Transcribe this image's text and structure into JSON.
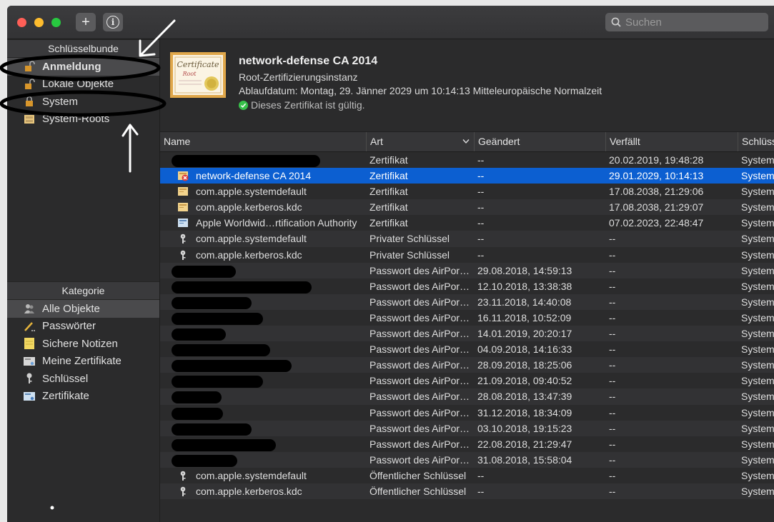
{
  "search": {
    "placeholder": "Suchen"
  },
  "sidebar": {
    "keychains_header": "Schlüsselbunde",
    "keychains": [
      {
        "label": "Anmeldung",
        "selected": true
      },
      {
        "label": "Lokale Objekte"
      },
      {
        "label": "System"
      },
      {
        "label": "System-Roots"
      }
    ],
    "category_header": "Kategorie",
    "categories": [
      {
        "label": "Alle Objekte",
        "selected": true
      },
      {
        "label": "Passwörter"
      },
      {
        "label": "Sichere Notizen"
      },
      {
        "label": "Meine Zertifikate"
      },
      {
        "label": "Schlüssel"
      },
      {
        "label": "Zertifikate"
      }
    ]
  },
  "detail": {
    "title": "network-defense CA 2014",
    "subtitle": "Root-Zertifizierungsinstanz",
    "expiry": "Ablaufdatum: Montag, 29. Jänner 2029 um 10:14:13 Mitteleuropäische Normalzeit",
    "valid": "Dieses Zertifikat ist gültig.",
    "cert_text1": "Certificate",
    "cert_text2": "Root"
  },
  "table": {
    "columns": [
      "Name",
      "Art",
      "Geändert",
      "Verfällt",
      "Schlüss"
    ],
    "rows": [
      {
        "name": "",
        "art": "Zertifikat",
        "mod": "--",
        "exp": "20.02.2019, 19:48:28",
        "kc": "System",
        "icon": "none",
        "redact": 208
      },
      {
        "name": "network-defense CA 2014",
        "art": "Zertifikat",
        "mod": "--",
        "exp": "29.01.2029, 10:14:13",
        "kc": "System",
        "icon": "cert-invalid",
        "selected": true
      },
      {
        "name": "com.apple.systemdefault",
        "art": "Zertifikat",
        "mod": "--",
        "exp": "17.08.2038, 21:29:06",
        "kc": "System",
        "icon": "cert"
      },
      {
        "name": "com.apple.kerberos.kdc",
        "art": "Zertifikat",
        "mod": "--",
        "exp": "17.08.2038, 21:29:07",
        "kc": "System",
        "icon": "cert"
      },
      {
        "name": "Apple Worldwid…rtification Authority",
        "art": "Zertifikat",
        "mod": "--",
        "exp": "07.02.2023, 22:48:47",
        "kc": "System",
        "icon": "cert-blue"
      },
      {
        "name": "com.apple.systemdefault",
        "art": "Privater Schlüssel",
        "mod": "--",
        "exp": "--",
        "kc": "System",
        "icon": "key"
      },
      {
        "name": "com.apple.kerberos.kdc",
        "art": "Privater Schlüssel",
        "mod": "--",
        "exp": "--",
        "kc": "System",
        "icon": "key"
      },
      {
        "name": "",
        "art": "Passwort des AirPor…",
        "mod": "29.08.2018, 14:59:13",
        "exp": "--",
        "kc": "System",
        "icon": "none",
        "redact": 90
      },
      {
        "name": "",
        "art": "Passwort des AirPor…",
        "mod": "12.10.2018, 13:38:38",
        "exp": "--",
        "kc": "System",
        "icon": "none",
        "redact": 196
      },
      {
        "name": "",
        "art": "Passwort des AirPor…",
        "mod": "23.11.2018, 14:40:08",
        "exp": "--",
        "kc": "System",
        "icon": "none",
        "redact": 112
      },
      {
        "name": "",
        "art": "Passwort des AirPor…",
        "mod": "16.11.2018, 10:52:09",
        "exp": "--",
        "kc": "System",
        "icon": "none",
        "redact": 128
      },
      {
        "name": "",
        "art": "Passwort des AirPor…",
        "mod": "14.01.2019, 20:20:17",
        "exp": "--",
        "kc": "System",
        "icon": "none",
        "redact": 76
      },
      {
        "name": "",
        "art": "Passwort des AirPor…",
        "mod": "04.09.2018, 14:16:33",
        "exp": "--",
        "kc": "System",
        "icon": "none",
        "redact": 138
      },
      {
        "name": "",
        "art": "Passwort des AirPor…",
        "mod": "28.09.2018, 18:25:06",
        "exp": "--",
        "kc": "System",
        "icon": "none",
        "redact": 168
      },
      {
        "name": "",
        "art": "Passwort des AirPor…",
        "mod": "21.09.2018, 09:40:52",
        "exp": "--",
        "kc": "System",
        "icon": "none",
        "redact": 128
      },
      {
        "name": "",
        "art": "Passwort des AirPor…",
        "mod": "28.08.2018, 13:47:39",
        "exp": "--",
        "kc": "System",
        "icon": "none",
        "redact": 70
      },
      {
        "name": "",
        "art": "Passwort des AirPor…",
        "mod": "31.12.2018, 18:34:09",
        "exp": "--",
        "kc": "System",
        "icon": "none",
        "redact": 72
      },
      {
        "name": "",
        "art": "Passwort des AirPor…",
        "mod": "03.10.2018, 19:15:23",
        "exp": "--",
        "kc": "System",
        "icon": "none",
        "redact": 112
      },
      {
        "name": "",
        "art": "Passwort des AirPor…",
        "mod": "22.08.2018, 21:29:47",
        "exp": "--",
        "kc": "System",
        "icon": "none",
        "redact": 146
      },
      {
        "name": "",
        "art": "Passwort des AirPor…",
        "mod": "31.08.2018, 15:58:04",
        "exp": "--",
        "kc": "System",
        "icon": "none",
        "redact": 92
      },
      {
        "name": "com.apple.systemdefault",
        "art": "Öffentlicher Schlüssel",
        "mod": "--",
        "exp": "--",
        "kc": "System",
        "icon": "key"
      },
      {
        "name": "com.apple.kerberos.kdc",
        "art": "Öffentlicher Schlüssel",
        "mod": "--",
        "exp": "--",
        "kc": "System",
        "icon": "key"
      }
    ]
  }
}
